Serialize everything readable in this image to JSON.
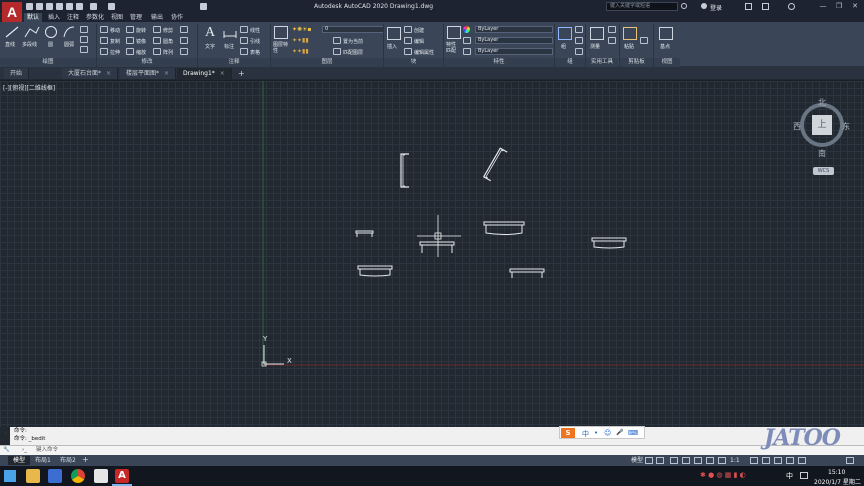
{
  "app": {
    "logo": "A",
    "title": "Autodesk AutoCAD 2020    Drawing1.dwg"
  },
  "search": {
    "placeholder": "键入关键字或短语"
  },
  "user": {
    "login": "登录"
  },
  "window_controls": [
    "—",
    "❐",
    "✕"
  ],
  "menu_tabs": [
    "默认",
    "插入",
    "注释",
    "参数化",
    "视图",
    "管理",
    "输出",
    "协作"
  ],
  "ribbon": {
    "draw": {
      "title": "绘图",
      "buttons": [
        "直线",
        "多段线",
        "圆",
        "圆弧"
      ]
    },
    "modify": {
      "title": "修改",
      "buttons": [
        "移动",
        "旋转",
        "修剪",
        "复制",
        "镜像",
        "圆角",
        "拉伸",
        "缩放",
        "阵列"
      ]
    },
    "annotation": {
      "title": "注释",
      "buttons": [
        "文字",
        "标注",
        "线性",
        "引线",
        "表格"
      ]
    },
    "layers": {
      "title": "图层",
      "layer_props": "图层特性",
      "layer_value": "0",
      "buttons": [
        "置为当前",
        "匹配图层"
      ]
    },
    "block": {
      "title": "块",
      "buttons": [
        "插入",
        "创建",
        "编辑",
        "编辑属性"
      ]
    },
    "properties": {
      "title": "特性",
      "match": "特性匹配",
      "values": [
        "ByLayer",
        "ByLayer",
        "ByLayer"
      ]
    },
    "groups": {
      "title": "组",
      "label": "组"
    },
    "utilities": {
      "title": "实用工具",
      "label": "测量"
    },
    "clipboard": {
      "title": "剪贴板",
      "label": "粘贴"
    },
    "view": {
      "title": "视图",
      "label": "基点"
    }
  },
  "file_tabs": [
    "开始",
    "大厦石台面*",
    "楼层平面图*",
    "Drawing1*"
  ],
  "viewport_label": "[-][俯视][二维线框]",
  "viewcube": {
    "north": "北",
    "south": "南",
    "east": "东",
    "west": "西",
    "top": "上",
    "wcs": "WCS"
  },
  "ucs": {
    "x": "X",
    "y": "Y"
  },
  "command": {
    "line1": "命令:",
    "line2": "命令: _bedit",
    "input_placeholder": "键入命令"
  },
  "layout_tabs": [
    "模型",
    "布局1",
    "布局2"
  ],
  "status": {
    "model": "模型",
    "scale": "1:1"
  },
  "ime": {
    "logo": "S",
    "items": [
      "中",
      "•",
      "☺",
      "🎤",
      "⌨"
    ]
  },
  "taskbar": {
    "time": "15:10",
    "date": "2020/1/7 星期二"
  },
  "watermark": "JATOO"
}
